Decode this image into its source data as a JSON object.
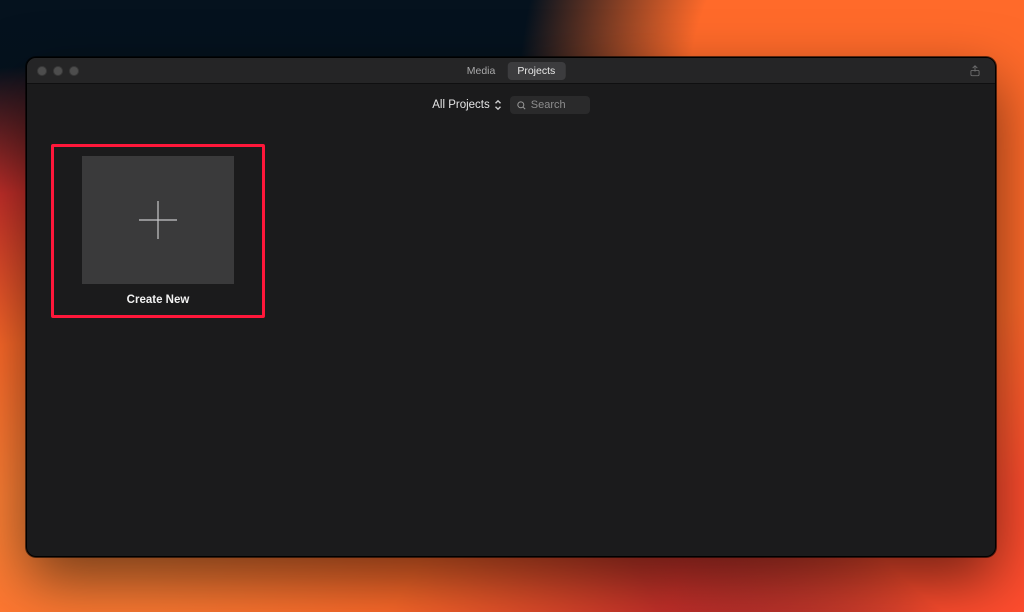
{
  "window": {
    "tabs": {
      "media": "Media",
      "projects": "Projects",
      "active": "projects"
    }
  },
  "toolbar": {
    "filter_label": "All Projects",
    "search_placeholder": "Search"
  },
  "grid": {
    "create_new_label": "Create New"
  }
}
